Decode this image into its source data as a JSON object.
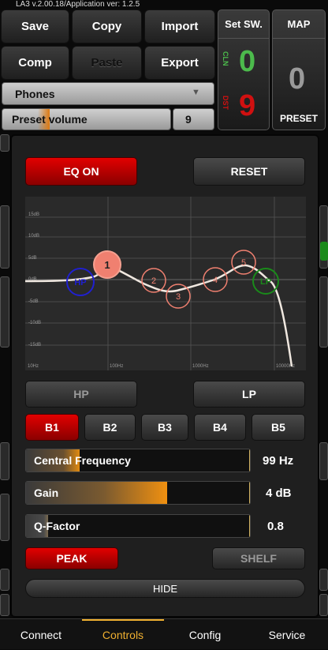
{
  "app": {
    "version": "LA3 v.2.00.18/Application ver: 1.2.5"
  },
  "toolbar": {
    "save": "Save",
    "copy": "Copy",
    "import": "Import",
    "comp": "Comp",
    "paste": "Paste",
    "export": "Export"
  },
  "output_select": {
    "value": "Phones"
  },
  "preset_volume": {
    "label": "Preset volume",
    "value": "9",
    "level": 0.28
  },
  "set_switch": {
    "title": "Set SW.",
    "cln_label": "CLN",
    "cln_value": "0",
    "dst_label": "DST",
    "dst_value": "9"
  },
  "map": {
    "title": "MAP",
    "value": "0",
    "preset_label": "PRESET"
  },
  "eq": {
    "eq_on_label": "EQ ON",
    "reset_label": "RESET",
    "graph": {
      "y_labels": [
        "15dB",
        "10dB",
        "5dB",
        "0dB",
        "-5dB",
        "-10dB",
        "-15dB"
      ],
      "x_labels": [
        "10Hz",
        "100Hz",
        "1000Hz",
        "10000Hz"
      ],
      "nodes": [
        "HP",
        "1",
        "2",
        "3",
        "4",
        "5",
        "LP"
      ]
    },
    "hp_label": "HP",
    "lp_label": "LP",
    "bands": [
      "B1",
      "B2",
      "B3",
      "B4",
      "B5"
    ],
    "params": {
      "central_frequency": {
        "label": "Central Frequency",
        "value": "99 Hz",
        "level": 0.24
      },
      "gain": {
        "label": "Gain",
        "value": "4 dB",
        "level": 0.63
      },
      "q_factor": {
        "label": "Q-Factor",
        "value": "0.8",
        "level": 0.1
      }
    },
    "peak_label": "PEAK",
    "shelf_label": "SHELF",
    "hide_label": "HIDE"
  },
  "nav": {
    "items": [
      "Connect",
      "Controls",
      "Config",
      "Service"
    ],
    "active": "Controls"
  },
  "colors": {
    "accent_red": "#e20000",
    "active_tab": "#f0b030",
    "hp_node": "#2020d0",
    "lp_node": "#1a8a1a",
    "cln_green": "#4cbb4c",
    "dst_red": "#d01010"
  }
}
